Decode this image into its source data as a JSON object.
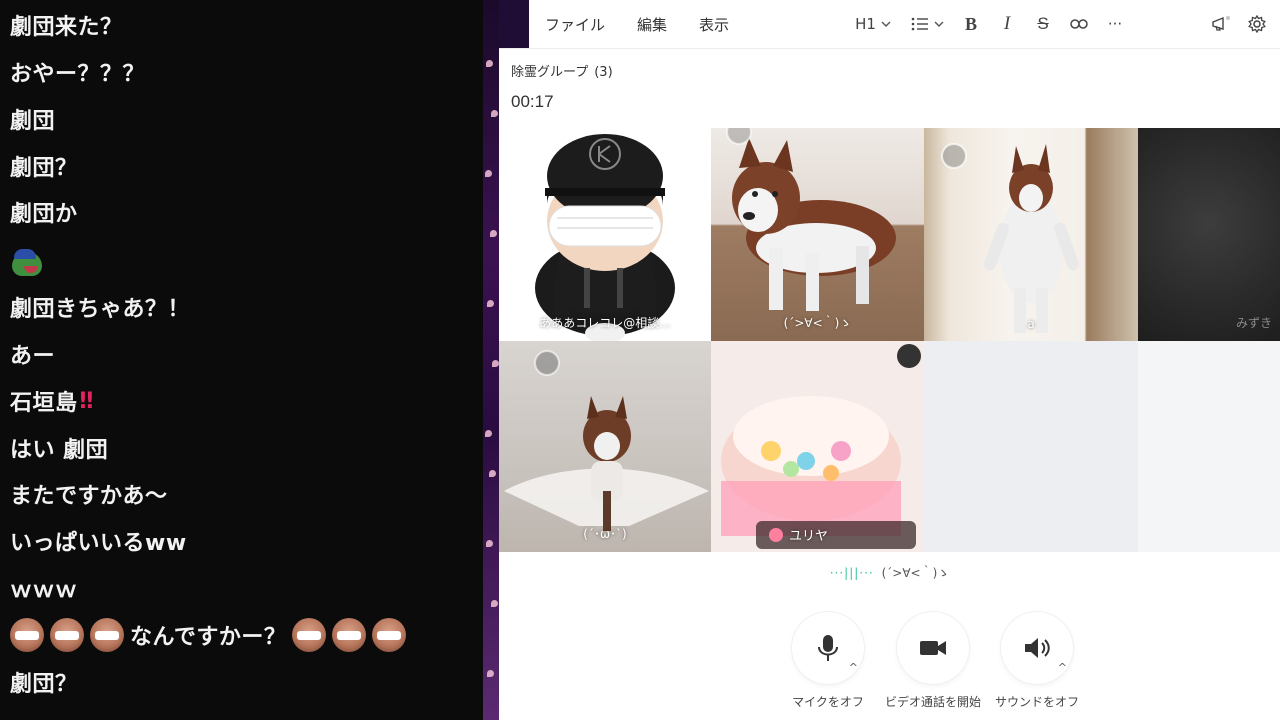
{
  "chat": {
    "messages": [
      {
        "text": "劇団来た？"
      },
      {
        "text": "おやー？？？"
      },
      {
        "text": "劇団"
      },
      {
        "text": "劇団？"
      },
      {
        "text": "劇団か"
      },
      {
        "text": "",
        "emote": "pepe-emote"
      },
      {
        "text": "劇団きちゃあ？！"
      },
      {
        "text": "あー"
      },
      {
        "text": "石垣島",
        "suffix": "‼"
      },
      {
        "text": "はい 劇団"
      },
      {
        "text": "またですかあ～"
      },
      {
        "text": "いっぱいいるww"
      },
      {
        "text": "ｗｗｗ"
      },
      {
        "text": "なんですかー？",
        "emote": "masked-face-emote"
      },
      {
        "text": "劇団？"
      }
    ]
  },
  "menubar": {
    "menus": [
      "ファイル",
      "編集",
      "表示"
    ]
  },
  "toolbar": {
    "heading": "H1",
    "bold": "B",
    "italic": "I",
    "strike": "S",
    "more": "···"
  },
  "call": {
    "group_name": "除霊グループ",
    "member_count": "(3)",
    "timer": "00:17",
    "tiles": [
      {
        "name": "あああコレコレ@相談..."
      },
      {
        "name": "(´>∀<｀)ゝ"
      },
      {
        "name": "a"
      },
      {
        "name": "みずき"
      },
      {
        "name": "(´･ω･`)"
      },
      {
        "name": "ユリヤ"
      }
    ],
    "speaking": "(´>∀<｀)ゝ",
    "speaking_wave": "···|||···",
    "controls": {
      "mic_label": "マイクをオフ",
      "video_label": "ビデオ通話を開始",
      "sound_label": "サウンドをオフ"
    }
  },
  "colors": {
    "chat_bg": "#0b0b0b",
    "chat_text": "#f2f2f2",
    "accent_wave": "#35c49a",
    "exclaim": "#e0245e"
  }
}
